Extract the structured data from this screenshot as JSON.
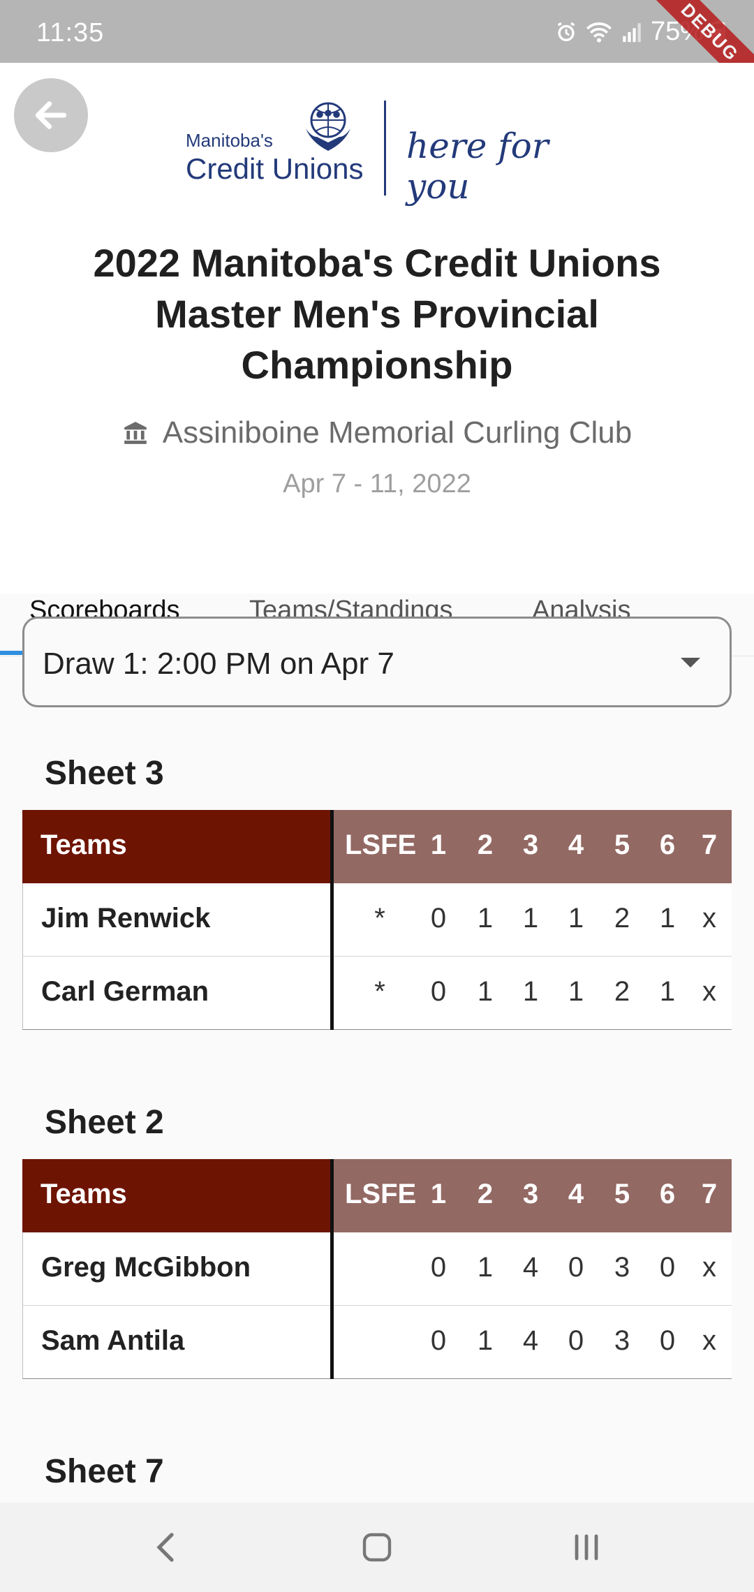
{
  "status_bar": {
    "time": "11:35",
    "battery": "75%"
  },
  "debug_banner": "DEBUG",
  "header": {
    "logo": {
      "org_small": "Manitoba's",
      "org_big": "Credit Unions",
      "tagline": "here for you"
    },
    "title": "2022 Manitoba's Credit Unions Master Men's Provincial Championship",
    "venue": "Assiniboine Memorial Curling Club",
    "dates": "Apr 7 - 11, 2022"
  },
  "tabs": [
    {
      "label": "Scoreboards",
      "active": true
    },
    {
      "label": "Teams/Standings",
      "active": false
    },
    {
      "label": "Analysis",
      "active": false
    }
  ],
  "draw_select": {
    "value": "Draw 1: 2:00 PM on Apr 7"
  },
  "score_columns": [
    "LSFE",
    "1",
    "2",
    "3",
    "4",
    "5",
    "6",
    "7"
  ],
  "teams_header": "Teams",
  "sheets": [
    {
      "title": "Sheet 3",
      "teams": [
        {
          "name": "Jim Renwick",
          "lsfe": "*",
          "ends": [
            "0",
            "1",
            "1",
            "1",
            "2",
            "1",
            "x"
          ]
        },
        {
          "name": "Carl German",
          "lsfe": "*",
          "ends": [
            "0",
            "1",
            "1",
            "1",
            "2",
            "1",
            "x"
          ]
        }
      ]
    },
    {
      "title": "Sheet 2",
      "teams": [
        {
          "name": "Greg McGibbon",
          "lsfe": "",
          "ends": [
            "0",
            "1",
            "4",
            "0",
            "3",
            "0",
            "x"
          ]
        },
        {
          "name": "Sam Antila",
          "lsfe": "",
          "ends": [
            "0",
            "1",
            "4",
            "0",
            "3",
            "0",
            "x"
          ]
        }
      ]
    },
    {
      "title": "Sheet 7",
      "teams": []
    }
  ],
  "colors": {
    "teams_header_bg": "#6e1403",
    "score_header_bg": "#936964",
    "tab_indicator": "#2f8fe0",
    "logo_blue": "#233a7a"
  }
}
